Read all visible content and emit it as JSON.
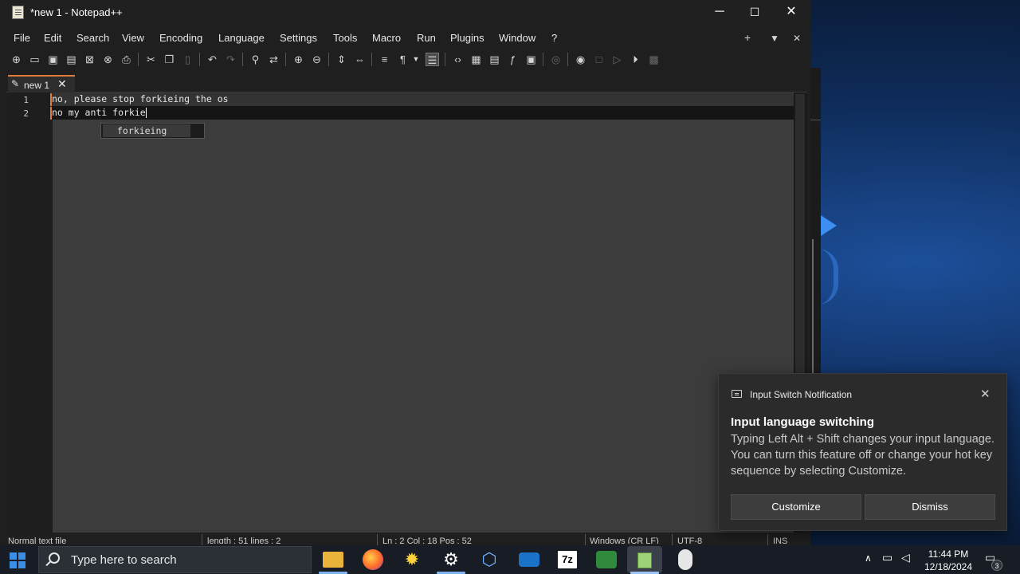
{
  "window": {
    "title": "*new 1 - Notepad++",
    "minimize": "─",
    "maximize": "☐",
    "close": "✕"
  },
  "menu": {
    "items": [
      "File",
      "Edit",
      "Search",
      "View",
      "Encoding",
      "Language",
      "Settings",
      "Tools",
      "Macro",
      "Run",
      "Plugins",
      "Window",
      "?"
    ],
    "right": [
      "+",
      "▼",
      "✕"
    ]
  },
  "toolbar": {
    "icons": [
      "new-file-icon",
      "open-file-icon",
      "save-icon",
      "save-all-icon",
      "close-icon",
      "close-all-icon",
      "print-icon",
      "cut-icon",
      "copy-icon",
      "paste-icon",
      "undo-icon",
      "redo-icon",
      "find-icon",
      "replace-icon",
      "zoom-in-icon",
      "zoom-out-icon",
      "sync-vertical-icon",
      "sync-horizontal-icon",
      "word-wrap-icon",
      "show-all-chars-icon",
      "dropdown-icon",
      "indent-guide-icon",
      "xml-tag-icon",
      "document-map-icon",
      "document-list-icon",
      "function-list-icon",
      "folder-as-workspace-icon",
      "monitoring-icon",
      "record-macro-icon",
      "stop-recording-icon",
      "playback-icon",
      "run-macro-multiple-icon",
      "save-macro-icon"
    ]
  },
  "tab": {
    "label": "new 1",
    "close": "✕"
  },
  "editor": {
    "lines": [
      {
        "number": "1",
        "text": "no, please stop forkieing the os"
      },
      {
        "number": "2",
        "text": "no my anti forkie"
      }
    ],
    "autocomplete": [
      "forkieing"
    ]
  },
  "statusbar": {
    "type": "Normal text file",
    "length": "length : 51    lines : 2",
    "position": "Ln : 2    Col : 18    Pos : 52",
    "eol": "Windows (CR LF)",
    "encoding": "UTF-8",
    "mode": "INS"
  },
  "notification": {
    "app": "Input Switch Notification",
    "close": "✕",
    "title": "Input language switching",
    "body": "Typing Left Alt + Shift changes your input language. You can turn this feature off or change your hot key sequence by selecting Customize.",
    "customize_label": "Customize",
    "dismiss_label": "Dismiss"
  },
  "taskbar": {
    "search_placeholder": "Type here to search",
    "apps": [
      "file-explorer-icon",
      "firefox-icon",
      "weather-app-icon",
      "settings-gear-icon",
      "virtualbox-icon",
      "photos-icon",
      "7zip-icon",
      "task-manager-icon",
      "notepad-plus-plus-icon",
      "mouse-icon"
    ],
    "zip_label": "7z",
    "time": "11:44 PM",
    "date": "12/18/2024",
    "notification_count": "3"
  },
  "colors": {
    "accent": "#e07b3a",
    "editor_bg": "#3c3c3c",
    "taskbar_bg": "#181c24",
    "toast_bg": "#2b2b2b"
  }
}
